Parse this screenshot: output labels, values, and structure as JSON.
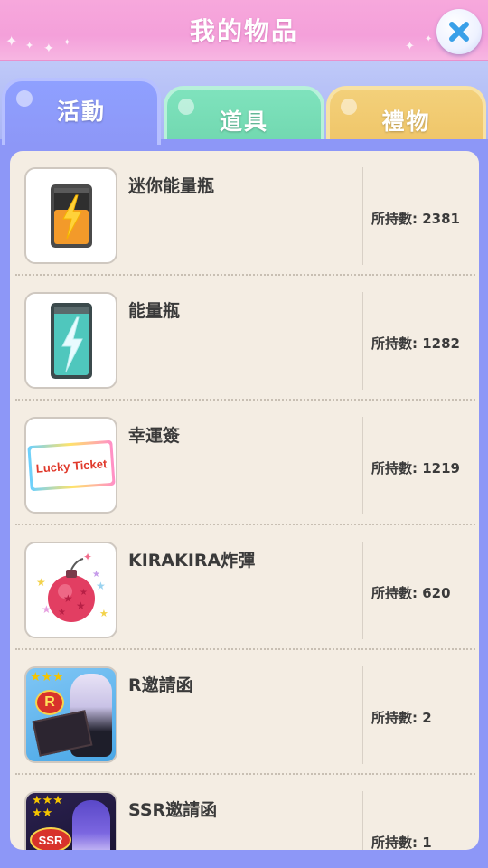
{
  "header": {
    "title": "我的物品"
  },
  "tabs": [
    {
      "label": "活動",
      "active": true
    },
    {
      "label": "道具",
      "active": false
    },
    {
      "label": "禮物",
      "active": false
    }
  ],
  "items": [
    {
      "name": "迷你能量瓶",
      "count_text": "所持數: 2381",
      "icon": "battery-orange-icon"
    },
    {
      "name": "能量瓶",
      "count_text": "所持數: 1282",
      "icon": "battery-teal-icon"
    },
    {
      "name": "幸運簽",
      "count_text": "所持數: 1219",
      "icon": "lucky-ticket-icon",
      "icon_text": "Lucky Ticket"
    },
    {
      "name": "KIRAKIRA炸彈",
      "count_text": "所持數: 620",
      "icon": "star-bomb-icon"
    },
    {
      "name": "R邀請函",
      "count_text": "所持數: 2",
      "icon": "r-invitation-icon",
      "icon_text": "R"
    },
    {
      "name": "SSR邀請函",
      "count_text": "所持數: 1",
      "icon": "ssr-invitation-icon",
      "icon_text": "SSR"
    }
  ],
  "colors": {
    "header": "#f4a0da",
    "tab_active": "#8d97f7",
    "tab_green": "#6fd6ae",
    "tab_yellow": "#efc466",
    "panel": "#f4ede3"
  }
}
